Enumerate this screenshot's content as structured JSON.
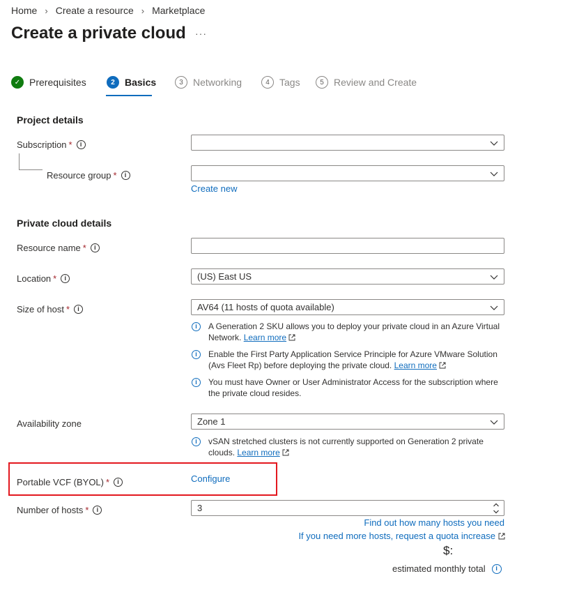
{
  "breadcrumb": [
    "Home",
    "Create a resource",
    "Marketplace"
  ],
  "page_title": "Create a private cloud",
  "more": "···",
  "steps": [
    {
      "num": "✓",
      "label": "Prerequisites",
      "state": "done"
    },
    {
      "num": "2",
      "label": "Basics",
      "state": "active"
    },
    {
      "num": "3",
      "label": "Networking",
      "state": "pending"
    },
    {
      "num": "4",
      "label": "Tags",
      "state": "pending"
    },
    {
      "num": "5",
      "label": "Review and Create",
      "state": "pending"
    }
  ],
  "project_details": {
    "title": "Project details",
    "subscription_label": "Subscription",
    "subscription_value": "",
    "resource_group_label": "Resource group",
    "resource_group_value": "",
    "create_new": "Create new"
  },
  "private_cloud_details": {
    "title": "Private cloud details",
    "resource_name_label": "Resource name",
    "resource_name_value": "",
    "location_label": "Location",
    "location_value": "(US) East US",
    "size_label": "Size of host",
    "size_value": "AV64 (11 hosts of quota available)",
    "notes": [
      {
        "text": "A Generation 2 SKU allows you to deploy your private cloud in an Azure Virtual Network.",
        "link": "Learn more"
      },
      {
        "text": "Enable the First Party Application Service Principle for Azure VMware Solution (Avs Fleet Rp) before deploying the private cloud.",
        "link": "Learn more"
      },
      {
        "text": "You must have Owner or User Administrator Access for the subscription where the private cloud resides.",
        "link": ""
      }
    ],
    "availability_label": "Availability zone",
    "availability_value": "Zone 1",
    "availability_note": {
      "text": "vSAN stretched clusters is not currently supported on Generation 2 private clouds.",
      "link": "Learn more"
    },
    "portable_vcf_label": "Portable VCF (BYOL)",
    "configure": "Configure",
    "hosts_label": "Number of hosts",
    "hosts_value": "3",
    "find_hosts": "Find out how many hosts you need",
    "quota_link": "If you need more hosts, request a quota increase",
    "price": "$:",
    "estimated": "estimated monthly total"
  },
  "required_mark": "*",
  "info_glyph": "i",
  "colors": {
    "accent": "#0f6cbd",
    "success": "#107c10",
    "required": "#a4262c",
    "highlight": "#e3181f"
  }
}
